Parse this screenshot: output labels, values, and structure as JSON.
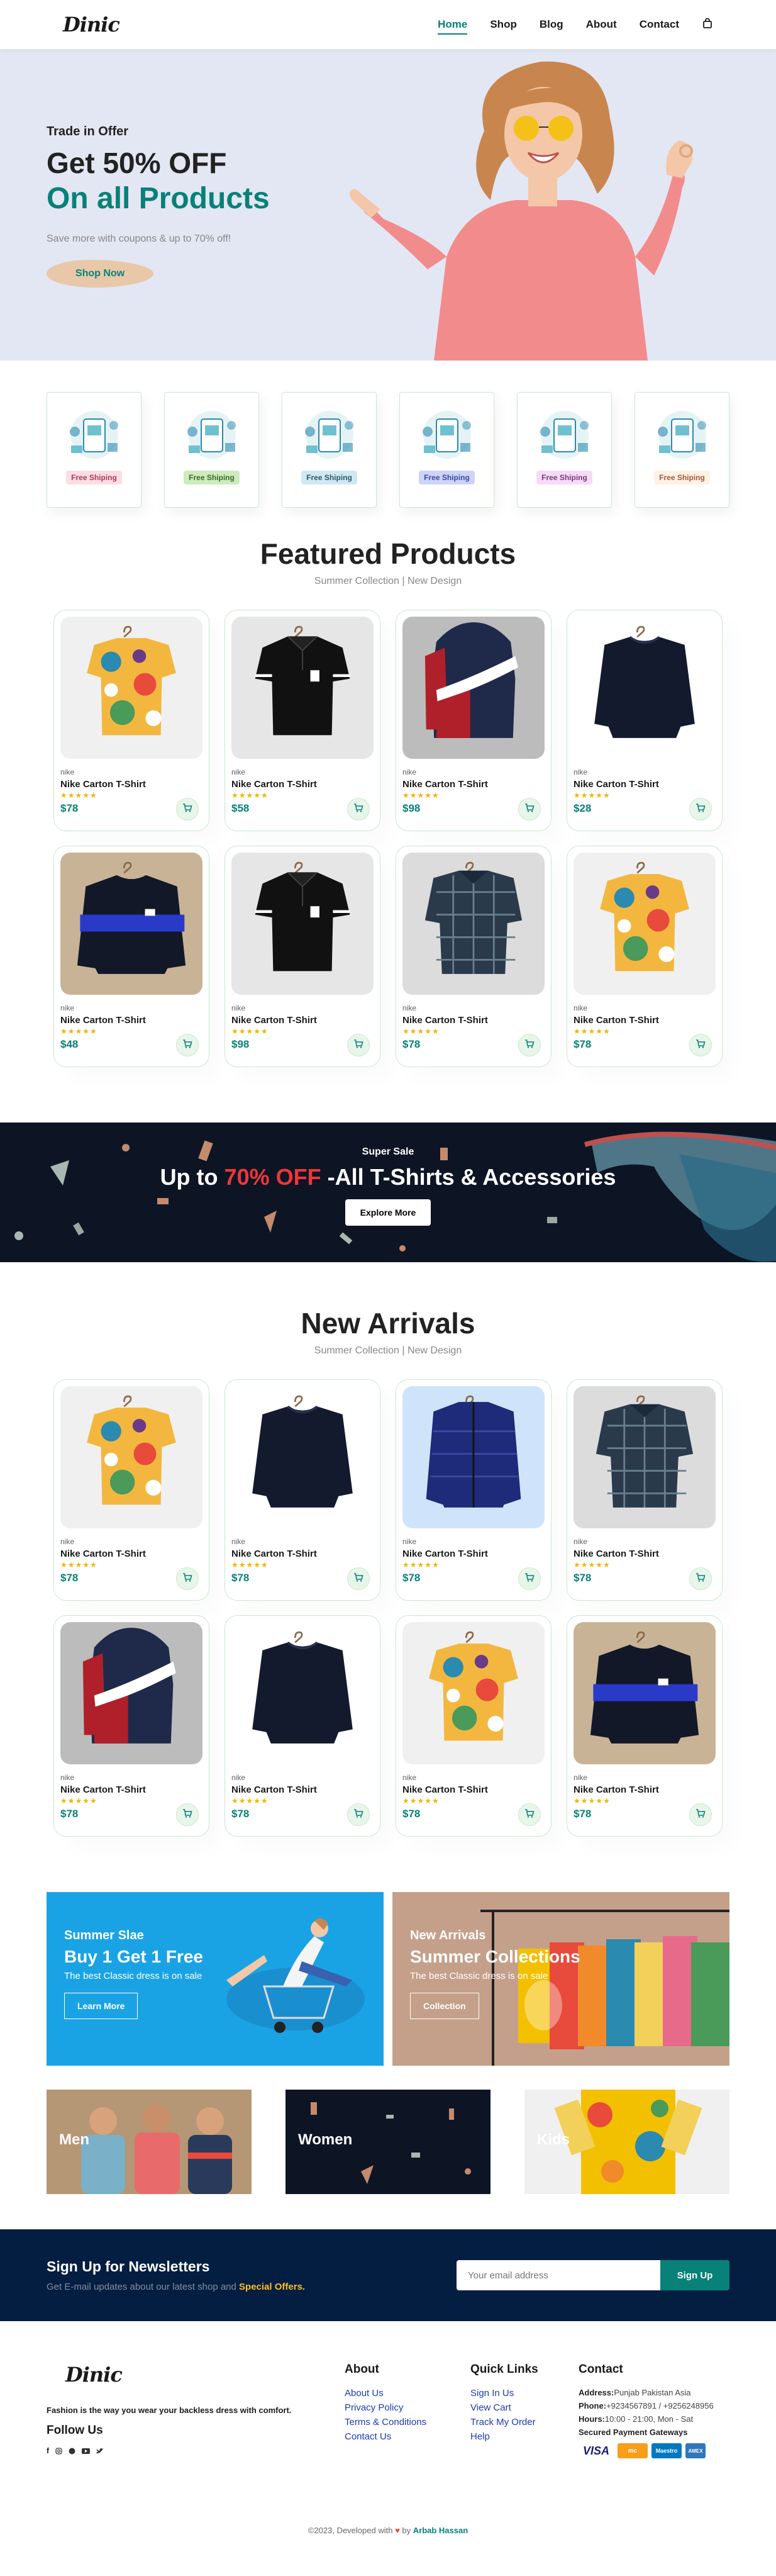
{
  "brand": "Dinic",
  "nav": [
    "Home",
    "Shop",
    "Blog",
    "About",
    "Contact"
  ],
  "hero": {
    "sub": "Trade in Offer",
    "title": "Get 50% OFF",
    "highlight": "On all Products",
    "desc": "Save more with coupons & up to 70% off!",
    "btn": "Shop Now"
  },
  "features": [
    {
      "tag": "Free Shiping",
      "bg": "#fddde4",
      "color": "#aa3a55"
    },
    {
      "tag": "Free Shiping",
      "bg": "#cdebbc",
      "color": "#3a6b2a"
    },
    {
      "tag": "Free Shiping",
      "bg": "#d1e8f2",
      "color": "#2a5a6b"
    },
    {
      "tag": "Free Shiping",
      "bg": "#cdd4f8",
      "color": "#3a4aa0"
    },
    {
      "tag": "Free Shiping",
      "bg": "#f6dbf6",
      "color": "#7a3a7a"
    },
    {
      "tag": "Free Shiping",
      "bg": "#fff2e5",
      "color": "#a05a3a"
    }
  ],
  "featured": {
    "title": "Featured Products",
    "sub": "Summer Collection | New Design",
    "products": [
      {
        "brand": "nike",
        "name": "Nike Carton T-Shirt",
        "price": "$78",
        "img": "floral"
      },
      {
        "brand": "nike",
        "name": "Nike Carton T-Shirt",
        "price": "$58",
        "img": "polo"
      },
      {
        "brand": "nike",
        "name": "Nike Carton T-Shirt",
        "price": "$98",
        "img": "jacketred"
      },
      {
        "brand": "nike",
        "name": "Nike Carton T-Shirt",
        "price": "$28",
        "img": "sweater"
      },
      {
        "brand": "nike",
        "name": "Nike Carton T-Shirt",
        "price": "$48",
        "img": "stripe"
      },
      {
        "brand": "nike",
        "name": "Nike Carton T-Shirt",
        "price": "$98",
        "img": "polo"
      },
      {
        "brand": "nike",
        "name": "Nike Carton T-Shirt",
        "price": "$78",
        "img": "check"
      },
      {
        "brand": "nike",
        "name": "Nike Carton T-Shirt",
        "price": "$78",
        "img": "floral"
      }
    ]
  },
  "stars": "★★★★★",
  "banner": {
    "pre": "Super Sale",
    "title_a": "Up to ",
    "title_b": "70% OFF",
    "title_c": " -All T-Shirts & Accessories",
    "btn": "Explore More"
  },
  "arrivals": {
    "title": "New Arrivals",
    "sub": "Summer Collection | New Design",
    "products": [
      {
        "brand": "nike",
        "name": "Nike Carton T-Shirt",
        "price": "$78",
        "img": "floral"
      },
      {
        "brand": "nike",
        "name": "Nike Carton T-Shirt",
        "price": "$78",
        "img": "sweater"
      },
      {
        "brand": "nike",
        "name": "Nike Carton T-Shirt",
        "price": "$78",
        "img": "puffer"
      },
      {
        "brand": "nike",
        "name": "Nike Carton T-Shirt",
        "price": "$78",
        "img": "check"
      },
      {
        "brand": "nike",
        "name": "Nike Carton T-Shirt",
        "price": "$78",
        "img": "jacketred"
      },
      {
        "brand": "nike",
        "name": "Nike Carton T-Shirt",
        "price": "$78",
        "img": "sweater"
      },
      {
        "brand": "nike",
        "name": "Nike Carton T-Shirt",
        "price": "$78",
        "img": "floral"
      },
      {
        "brand": "nike",
        "name": "Nike Carton T-Shirt",
        "price": "$78",
        "img": "stripe"
      }
    ]
  },
  "promo1": {
    "sub": "Summer Slae",
    "title": "Buy 1 Get 1 Free",
    "desc": "The best Classic dress is on sale",
    "btn": "Learn More"
  },
  "promo2": {
    "sub": "New Arrivals",
    "title": "Summer Collections",
    "desc": "The best Classic dress is on sale",
    "btn": "Collection"
  },
  "cats": [
    "Men",
    "Women",
    "Kids"
  ],
  "newsletter": {
    "title": "Sign Up for Newsletters",
    "desc_a": "Get E-mail updates about our latest shop and ",
    "desc_b": "Special Offers.",
    "placeholder": "Your email address",
    "btn": "Sign Up"
  },
  "footer": {
    "tagline": "Fashion is the way you wear your backless dress with comfort.",
    "follow": "Follow Us",
    "about_title": "About",
    "about": [
      "About Us",
      "Privacy Policy",
      "Terms & Conditions",
      "Contact Us"
    ],
    "quick_title": "Quick Links",
    "quick": [
      "Sign In Us",
      "View Cart",
      "Track My Order",
      "Help"
    ],
    "contact_title": "Contact",
    "address_label": "Address:",
    "address": "Punjab Pakistan Asia",
    "phone_label": "Phone:",
    "phone": "+9234567891 / +9256248956",
    "hours_label": "Hours:",
    "hours": "10:00 - 21:00, Mon - Sat",
    "pay_title": "Secured Payment Gateways",
    "payments": [
      "VISA",
      "mc",
      "Maestro",
      "AMEX"
    ],
    "copy_a": "©2023, Developed with ",
    "copy_b": " by ",
    "author": "Arbab Hassan"
  }
}
